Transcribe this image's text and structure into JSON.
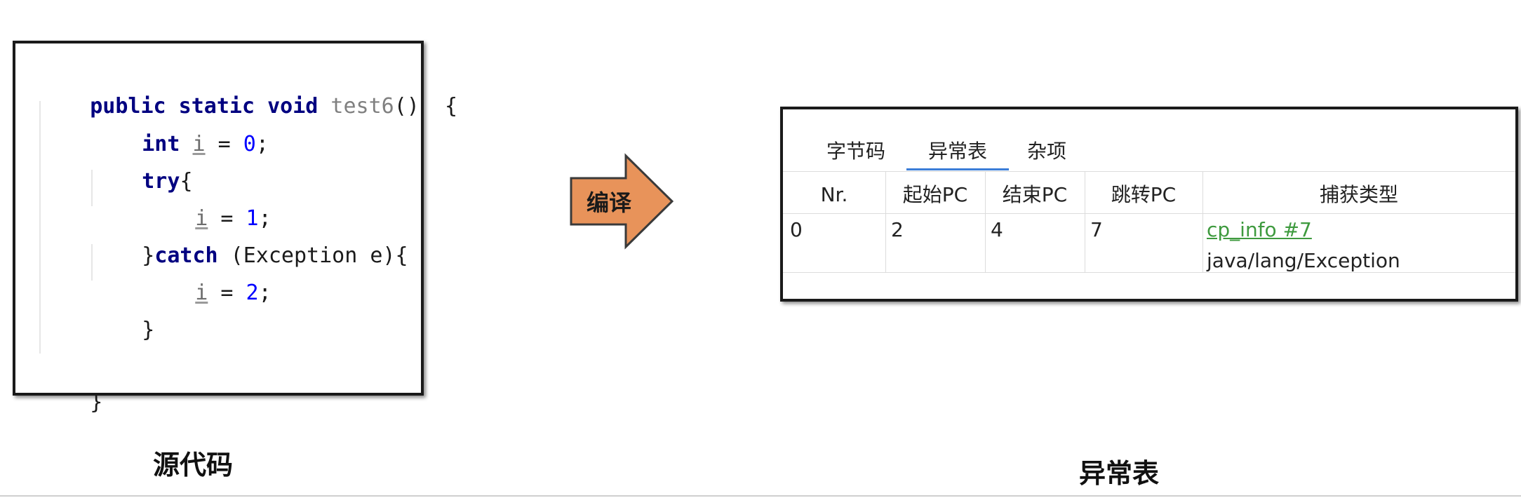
{
  "code": {
    "line1": {
      "kw": "public static void ",
      "fn": "test6",
      "rest": "()  {"
    },
    "line2": {
      "kw": "int ",
      "var": "i",
      "op": " = ",
      "num": "0",
      "end": ";"
    },
    "line3": {
      "kw": "try",
      "end": "{"
    },
    "line4": {
      "var": "i",
      "op": " = ",
      "num": "1",
      "end": ";"
    },
    "line5": {
      "brace": "}",
      "kw": "catch",
      "rest": " (Exception e){"
    },
    "line6": {
      "var": "i",
      "op": " = ",
      "num": "2",
      "end": ";"
    },
    "line7": "}",
    "line8": "}"
  },
  "source_caption": "源代码",
  "arrow_label": "编译",
  "table_caption": "异常表",
  "tabs": [
    "字节码",
    "异常表",
    "杂项"
  ],
  "active_tab": "异常表",
  "table": {
    "headers": [
      "Nr.",
      "起始PC",
      "结束PC",
      "跳转PC",
      "捕获类型"
    ],
    "rows": [
      {
        "nr": "0",
        "start_pc": "2",
        "end_pc": "4",
        "handler_pc": "7",
        "catch_link": "cp_info #7",
        "catch_type": "java/lang/Exception"
      }
    ]
  },
  "colors": {
    "keyword": "#000080",
    "number": "#0000ff",
    "method": "#808080",
    "link": "#3e9a3e",
    "arrow_fill": "#e8935a",
    "tab_underline": "#3b7dd8"
  }
}
